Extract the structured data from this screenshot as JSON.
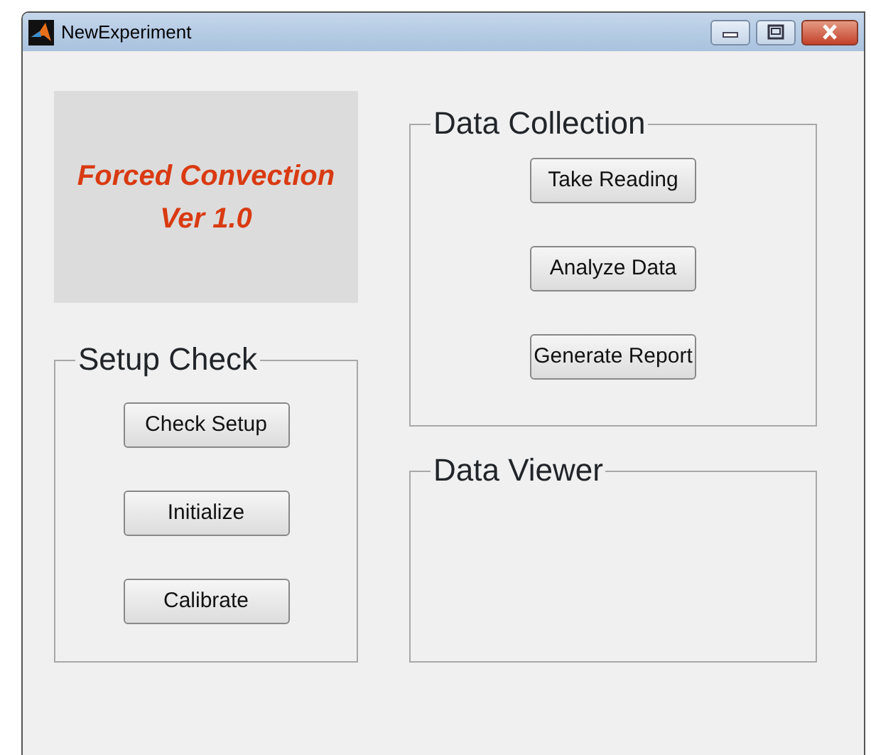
{
  "window": {
    "title": "NewExperiment"
  },
  "banner": {
    "lines": [
      "Forced Convection",
      "Ver 1.0"
    ]
  },
  "panels": [
    {
      "title": "Setup Check",
      "buttons": [
        "Check Setup",
        "Initialize",
        "Calibrate"
      ]
    },
    {
      "title": "Data Collection",
      "buttons": [
        "Take Reading",
        "Analyze Data",
        "Generate Report"
      ]
    },
    {
      "title": "Data Viewer"
    }
  ]
}
